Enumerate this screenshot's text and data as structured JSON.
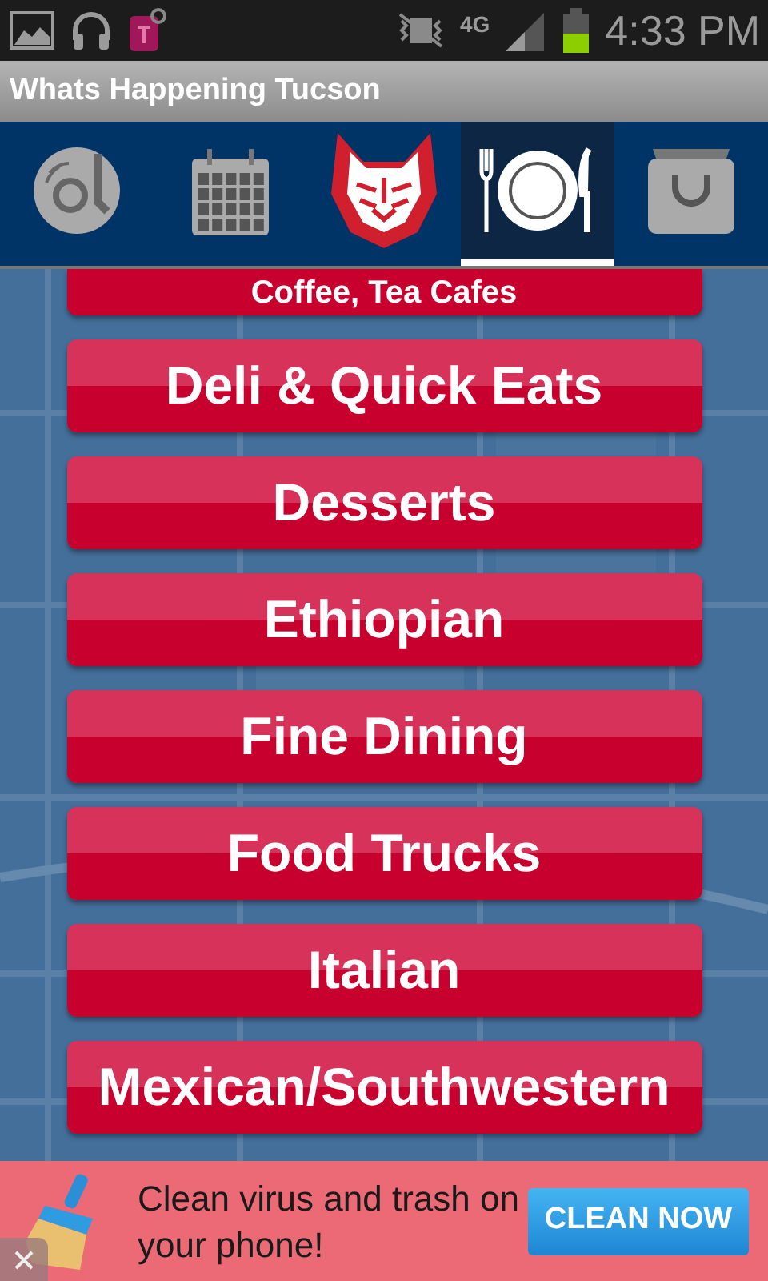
{
  "status_bar": {
    "network": "4G",
    "time": "4:33 PM"
  },
  "window": {
    "title": "Whats Happening Tucson"
  },
  "tabs": [
    {
      "kind": "music",
      "selected": false
    },
    {
      "kind": "calendar",
      "selected": false
    },
    {
      "kind": "mascot",
      "selected": false
    },
    {
      "kind": "dining",
      "selected": true
    },
    {
      "kind": "shopping",
      "selected": false
    }
  ],
  "categories": [
    {
      "label": "Coffee, Tea Cafes",
      "partial": true
    },
    {
      "label": "Deli & Quick Eats",
      "partial": false
    },
    {
      "label": "Desserts",
      "partial": false
    },
    {
      "label": "Ethiopian",
      "partial": false
    },
    {
      "label": "Fine Dining",
      "partial": false
    },
    {
      "label": "Food Trucks",
      "partial": false
    },
    {
      "label": "Italian",
      "partial": false
    },
    {
      "label": "Mexican/Southwestern",
      "partial": false
    }
  ],
  "ad": {
    "text": "Clean virus and trash on your phone!",
    "button": "CLEAN NOW"
  }
}
